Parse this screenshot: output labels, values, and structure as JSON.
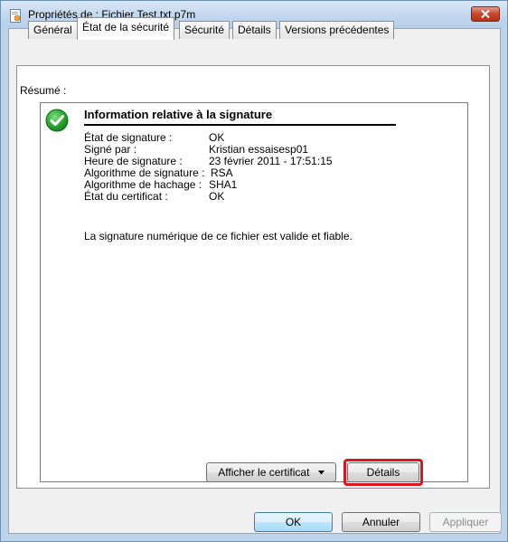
{
  "window": {
    "title": "Propriétés de : Fichier Test.txt.p7m"
  },
  "tabs": [
    {
      "label": "Général"
    },
    {
      "label": "État de la sécurité"
    },
    {
      "label": "Sécurité"
    },
    {
      "label": "Détails"
    },
    {
      "label": "Versions précédentes"
    }
  ],
  "summary": {
    "label": "Résumé :",
    "heading": "Information relative à la signature",
    "rows": [
      {
        "label": "État de signature :",
        "value": "OK"
      },
      {
        "label": "Signé par :",
        "value": "Kristian essaisesp01"
      },
      {
        "label": "Heure de signature :",
        "value": "23 février 2011 - 17:51:15"
      },
      {
        "label": "Algorithme de signature :",
        "value": "RSA"
      },
      {
        "label": "Algorithme de hachage :",
        "value": "SHA1"
      },
      {
        "label": "État du certificat :",
        "value": "OK"
      }
    ],
    "message": "La signature numérique de ce fichier est valide et fiable."
  },
  "panel_buttons": {
    "view_certificate": "Afficher le certificat",
    "details": "Détails"
  },
  "dialog_buttons": {
    "ok": "OK",
    "cancel": "Annuler",
    "apply": "Appliquer"
  },
  "icons": {
    "title": "document-certificate-icon",
    "status": "green-check-icon",
    "close": "close-icon",
    "dropdown": "dropdown-arrow-icon"
  },
  "colors": {
    "close_button": "#c7462c",
    "status_check": "#1e9a2b",
    "highlight": "#e0141e"
  }
}
